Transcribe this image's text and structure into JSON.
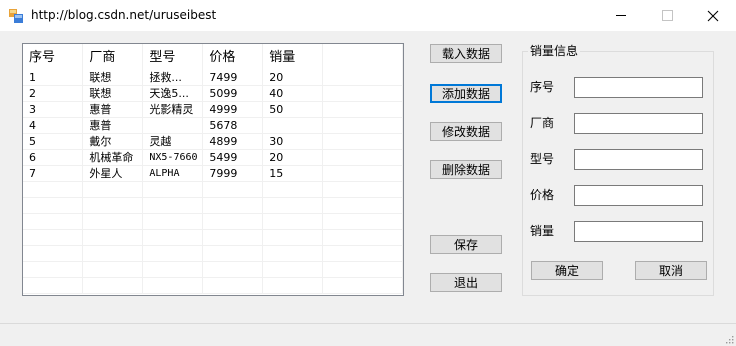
{
  "window": {
    "title": "http://blog.csdn.net/uruseibest"
  },
  "grid": {
    "columns": [
      "序号",
      "厂商",
      "型号",
      "价格",
      "销量"
    ],
    "rows": [
      [
        "1",
        "联想",
        "拯救...",
        "7499",
        "20"
      ],
      [
        "2",
        "联想",
        "天逸5...",
        "5099",
        "40"
      ],
      [
        "3",
        "惠普",
        "光影精灵",
        "4999",
        "50"
      ],
      [
        "4",
        "惠普",
        "",
        "5678",
        ""
      ],
      [
        "5",
        "戴尔",
        "灵越",
        "4899",
        "30"
      ],
      [
        "6",
        "机械革命",
        "NX5-7660",
        "5499",
        "20"
      ],
      [
        "7",
        "外星人",
        "ALPHA",
        "7999",
        "15"
      ]
    ]
  },
  "buttons": {
    "load": "载入数据",
    "add": "添加数据",
    "edit": "修改数据",
    "delete": "删除数据",
    "save": "保存",
    "exit": "退出"
  },
  "sales_info": {
    "title": "销量信息",
    "fields": {
      "id": {
        "label": "序号",
        "value": ""
      },
      "vendor": {
        "label": "厂商",
        "value": ""
      },
      "model": {
        "label": "型号",
        "value": ""
      },
      "price": {
        "label": "价格",
        "value": ""
      },
      "sales": {
        "label": "销量",
        "value": ""
      }
    },
    "confirm": "确定",
    "cancel": "取消"
  },
  "colors": {
    "focus": "#0078d7",
    "window_bg": "#f0f0f0"
  }
}
